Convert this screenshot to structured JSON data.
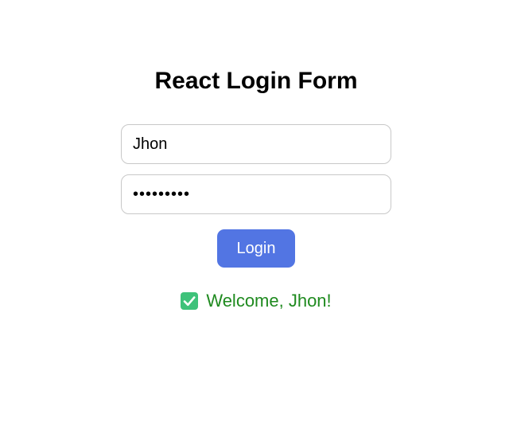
{
  "form": {
    "title": "React Login Form",
    "username_value": "Jhon",
    "password_value": "•••••••••",
    "login_label": "Login"
  },
  "status": {
    "icon": "check-mark-icon",
    "message": "Welcome, Jhon!"
  },
  "colors": {
    "button": "#5275e3",
    "success_text": "#1f8a1f",
    "success_icon": "#3ec27a"
  }
}
